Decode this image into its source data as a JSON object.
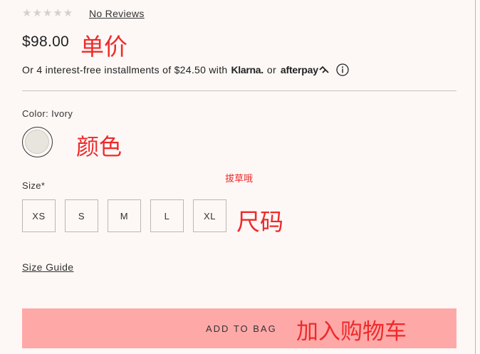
{
  "rating": {
    "stars": "★★★★★",
    "reviews_link": "No Reviews"
  },
  "price": "$98.00",
  "annotations": {
    "price": "单价",
    "color": "颜色",
    "small": "拔草哦",
    "size": "尺码",
    "add_to_bag": "加入购物车"
  },
  "installments": {
    "text": "Or 4 interest-free installments of $24.50 with",
    "klarna": "Klarna.",
    "or": "or",
    "afterpay": "afterpay"
  },
  "color": {
    "label": "Color: Ivory",
    "swatch_color": "#e7e5de"
  },
  "size": {
    "label": "Size*",
    "options": [
      "XS",
      "S",
      "M",
      "L",
      "XL"
    ]
  },
  "size_guide": "Size Guide",
  "add_to_bag": {
    "label": "ADD TO BAG",
    "color": "#fea9a8"
  }
}
